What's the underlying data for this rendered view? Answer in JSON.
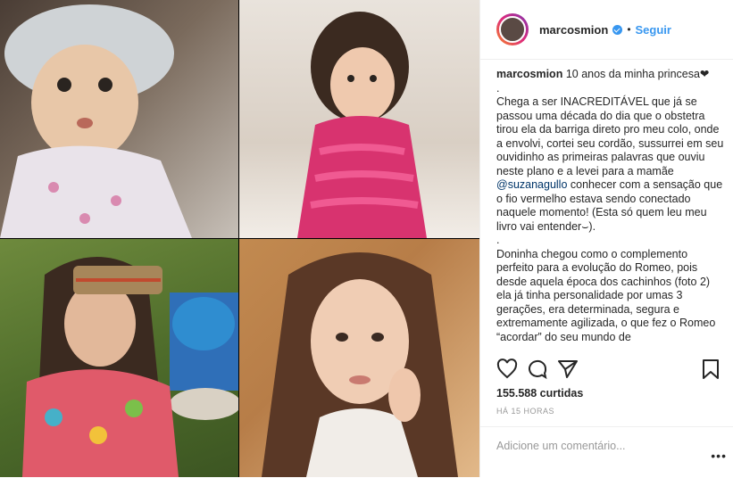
{
  "post": {
    "photos": [
      {
        "name": "baby-in-bonnet-photo",
        "colors": [
          "#4a3d35",
          "#c7c0b8"
        ]
      },
      {
        "name": "toddler-pink-dress-photo",
        "colors": [
          "#e9e3dc",
          "#d8336f"
        ]
      },
      {
        "name": "girl-headband-photo",
        "colors": [
          "#4d6b2a",
          "#2f8dd0"
        ]
      },
      {
        "name": "girl-portrait-photo",
        "colors": [
          "#c28a50",
          "#f1ede8"
        ]
      }
    ]
  },
  "header": {
    "username": "marcosmion",
    "separator": "•",
    "follow_label": "Seguir",
    "avatar_icon": "avatar-icon",
    "verified_icon": "verified-badge-icon"
  },
  "caption": {
    "username": "marcosmion",
    "first_line": "10 anos da minha princesa❤",
    "body_part1": ".\nChega a ser INACREDITÁVEL que já se passou uma década do dia que o obstetra tirou ela da barriga direto pro meu colo, onde a envolvi, cortei seu cordão, sussurrei em seu ouvidinho as primeiras palavras que ouviu neste plano e a levei para a mamãe ",
    "mention": "@suzanagullo",
    "body_part2": " conhecer com a sensação que o fio vermelho estava sendo conectado naquele momento! (Esta só quem leu meu livro vai entender⌣).\n.\nDoninha chegou como o complemento perfeito para a evolução do Romeo, pois desde aquela época dos cachinhos (foto 2) ela já tinha personalidade por umas 3 gerações, era determinada, segura e extremamente agilizada, o que fez o Romeo “acordar” do seu mundo de"
  },
  "actions": {
    "like_icon": "heart-icon",
    "comment_icon": "comment-icon",
    "share_icon": "share-icon",
    "save_icon": "bookmark-icon"
  },
  "likes": "155.588 curtidas",
  "timestamp": "HÁ 15 HORAS",
  "comment": {
    "placeholder": "Adicione um comentário...",
    "more_label": "•••"
  },
  "colors": {
    "link": "#3897f0",
    "mention": "#003569",
    "border": "#efefef"
  }
}
